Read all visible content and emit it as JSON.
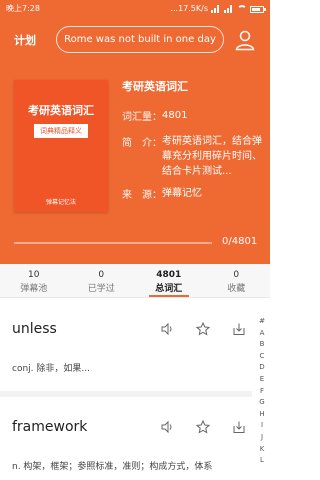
{
  "status_bar": {
    "time": "晚上7:28",
    "network": "...17.5K/s"
  },
  "header": {
    "plan_label": "计划",
    "search_placeholder": "Rome was not built in one day",
    "user_icon": "user-icon"
  },
  "book": {
    "cover_title": "考研英语词汇",
    "cover_subtitle": "词典精品释义",
    "cover_publisher": "弹幕记忆法",
    "title": "考研英语词汇",
    "count_label": "词汇量：",
    "count_value": "4801",
    "intro_label": "简　介：",
    "intro_value": "考研英语词汇，结合弹幕充分利用碎片时间、结合卡片测试...",
    "source_label": "来　源：",
    "source_value": "弹幕记忆"
  },
  "progress": {
    "text": "0/4801",
    "learned": 0,
    "total": 4801
  },
  "stats": [
    {
      "num": "10",
      "label": "弹幕池"
    },
    {
      "num": "0",
      "label": "已学过"
    },
    {
      "num": "4801",
      "label": "总词汇"
    },
    {
      "num": "0",
      "label": "收藏"
    }
  ],
  "active_stat_index": 2,
  "words": [
    {
      "word": "unless",
      "definition": "conj. 除非，如果..."
    },
    {
      "word": "framework",
      "definition": "n. 构架，框架；参照标准，准则；构成方式，体系"
    }
  ],
  "alphabet": [
    "#",
    "A",
    "B",
    "C",
    "D",
    "E",
    "F",
    "G",
    "H",
    "I",
    "J",
    "K",
    "L"
  ],
  "colors": {
    "accent": "#ef6a33",
    "cover": "#f05528"
  }
}
